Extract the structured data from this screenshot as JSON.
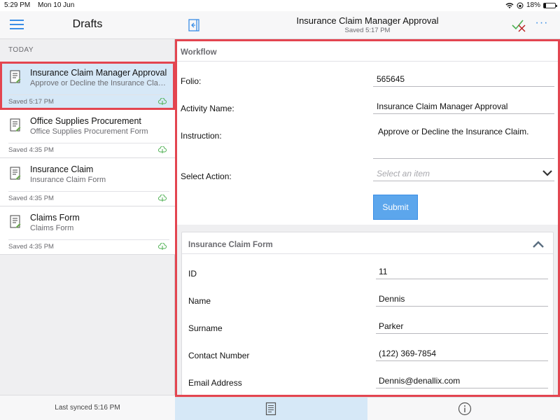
{
  "status_bar": {
    "time": "5:29 PM",
    "date": "Mon 10 Jun",
    "battery": "18%",
    "battery_level": 0.18
  },
  "sidebar": {
    "title": "Drafts",
    "section": "TODAY",
    "items": [
      {
        "title": "Insurance Claim Manager Approval",
        "subtitle": "Approve or Decline the Insurance Claim.",
        "saved": "Saved 5:17 PM",
        "selected": true
      },
      {
        "title": "Office Supplies Procurement",
        "subtitle": "Office Supplies Procurement Form",
        "saved": "Saved 4:35 PM"
      },
      {
        "title": "Insurance Claim",
        "subtitle": "Insurance Claim Form",
        "saved": "Saved 4:35 PM"
      },
      {
        "title": "Claims Form",
        "subtitle": "Claims Form",
        "saved": "Saved 4:35 PM"
      }
    ],
    "footer": "Last synced 5:16 PM"
  },
  "header": {
    "title": "Insurance Claim Manager Approval",
    "subtitle": "Saved 5:17 PM",
    "more": "···"
  },
  "workflow": {
    "heading": "Workflow",
    "folio_label": "Folio:",
    "folio_value": "565645",
    "activity_label": "Activity Name:",
    "activity_value": "Insurance Claim Manager Approval",
    "instruction_label": "Instruction:",
    "instruction_value": "Approve or Decline the Insurance Claim.",
    "action_label": "Select Action:",
    "action_placeholder": "Select an item",
    "submit": "Submit"
  },
  "claim_form": {
    "heading": "Insurance Claim Form",
    "fields": [
      {
        "label": "ID",
        "value": "11"
      },
      {
        "label": "Name",
        "value": "Dennis"
      },
      {
        "label": "Surname",
        "value": "Parker"
      },
      {
        "label": "Contact Number",
        "value": "(122) 369-7854"
      },
      {
        "label": "Email Address",
        "value": "Dennis@denallix.com"
      }
    ]
  },
  "colors": {
    "accent": "#3a8ee6",
    "highlight_border": "#e34550",
    "selected_bg": "#d6e8f7"
  }
}
